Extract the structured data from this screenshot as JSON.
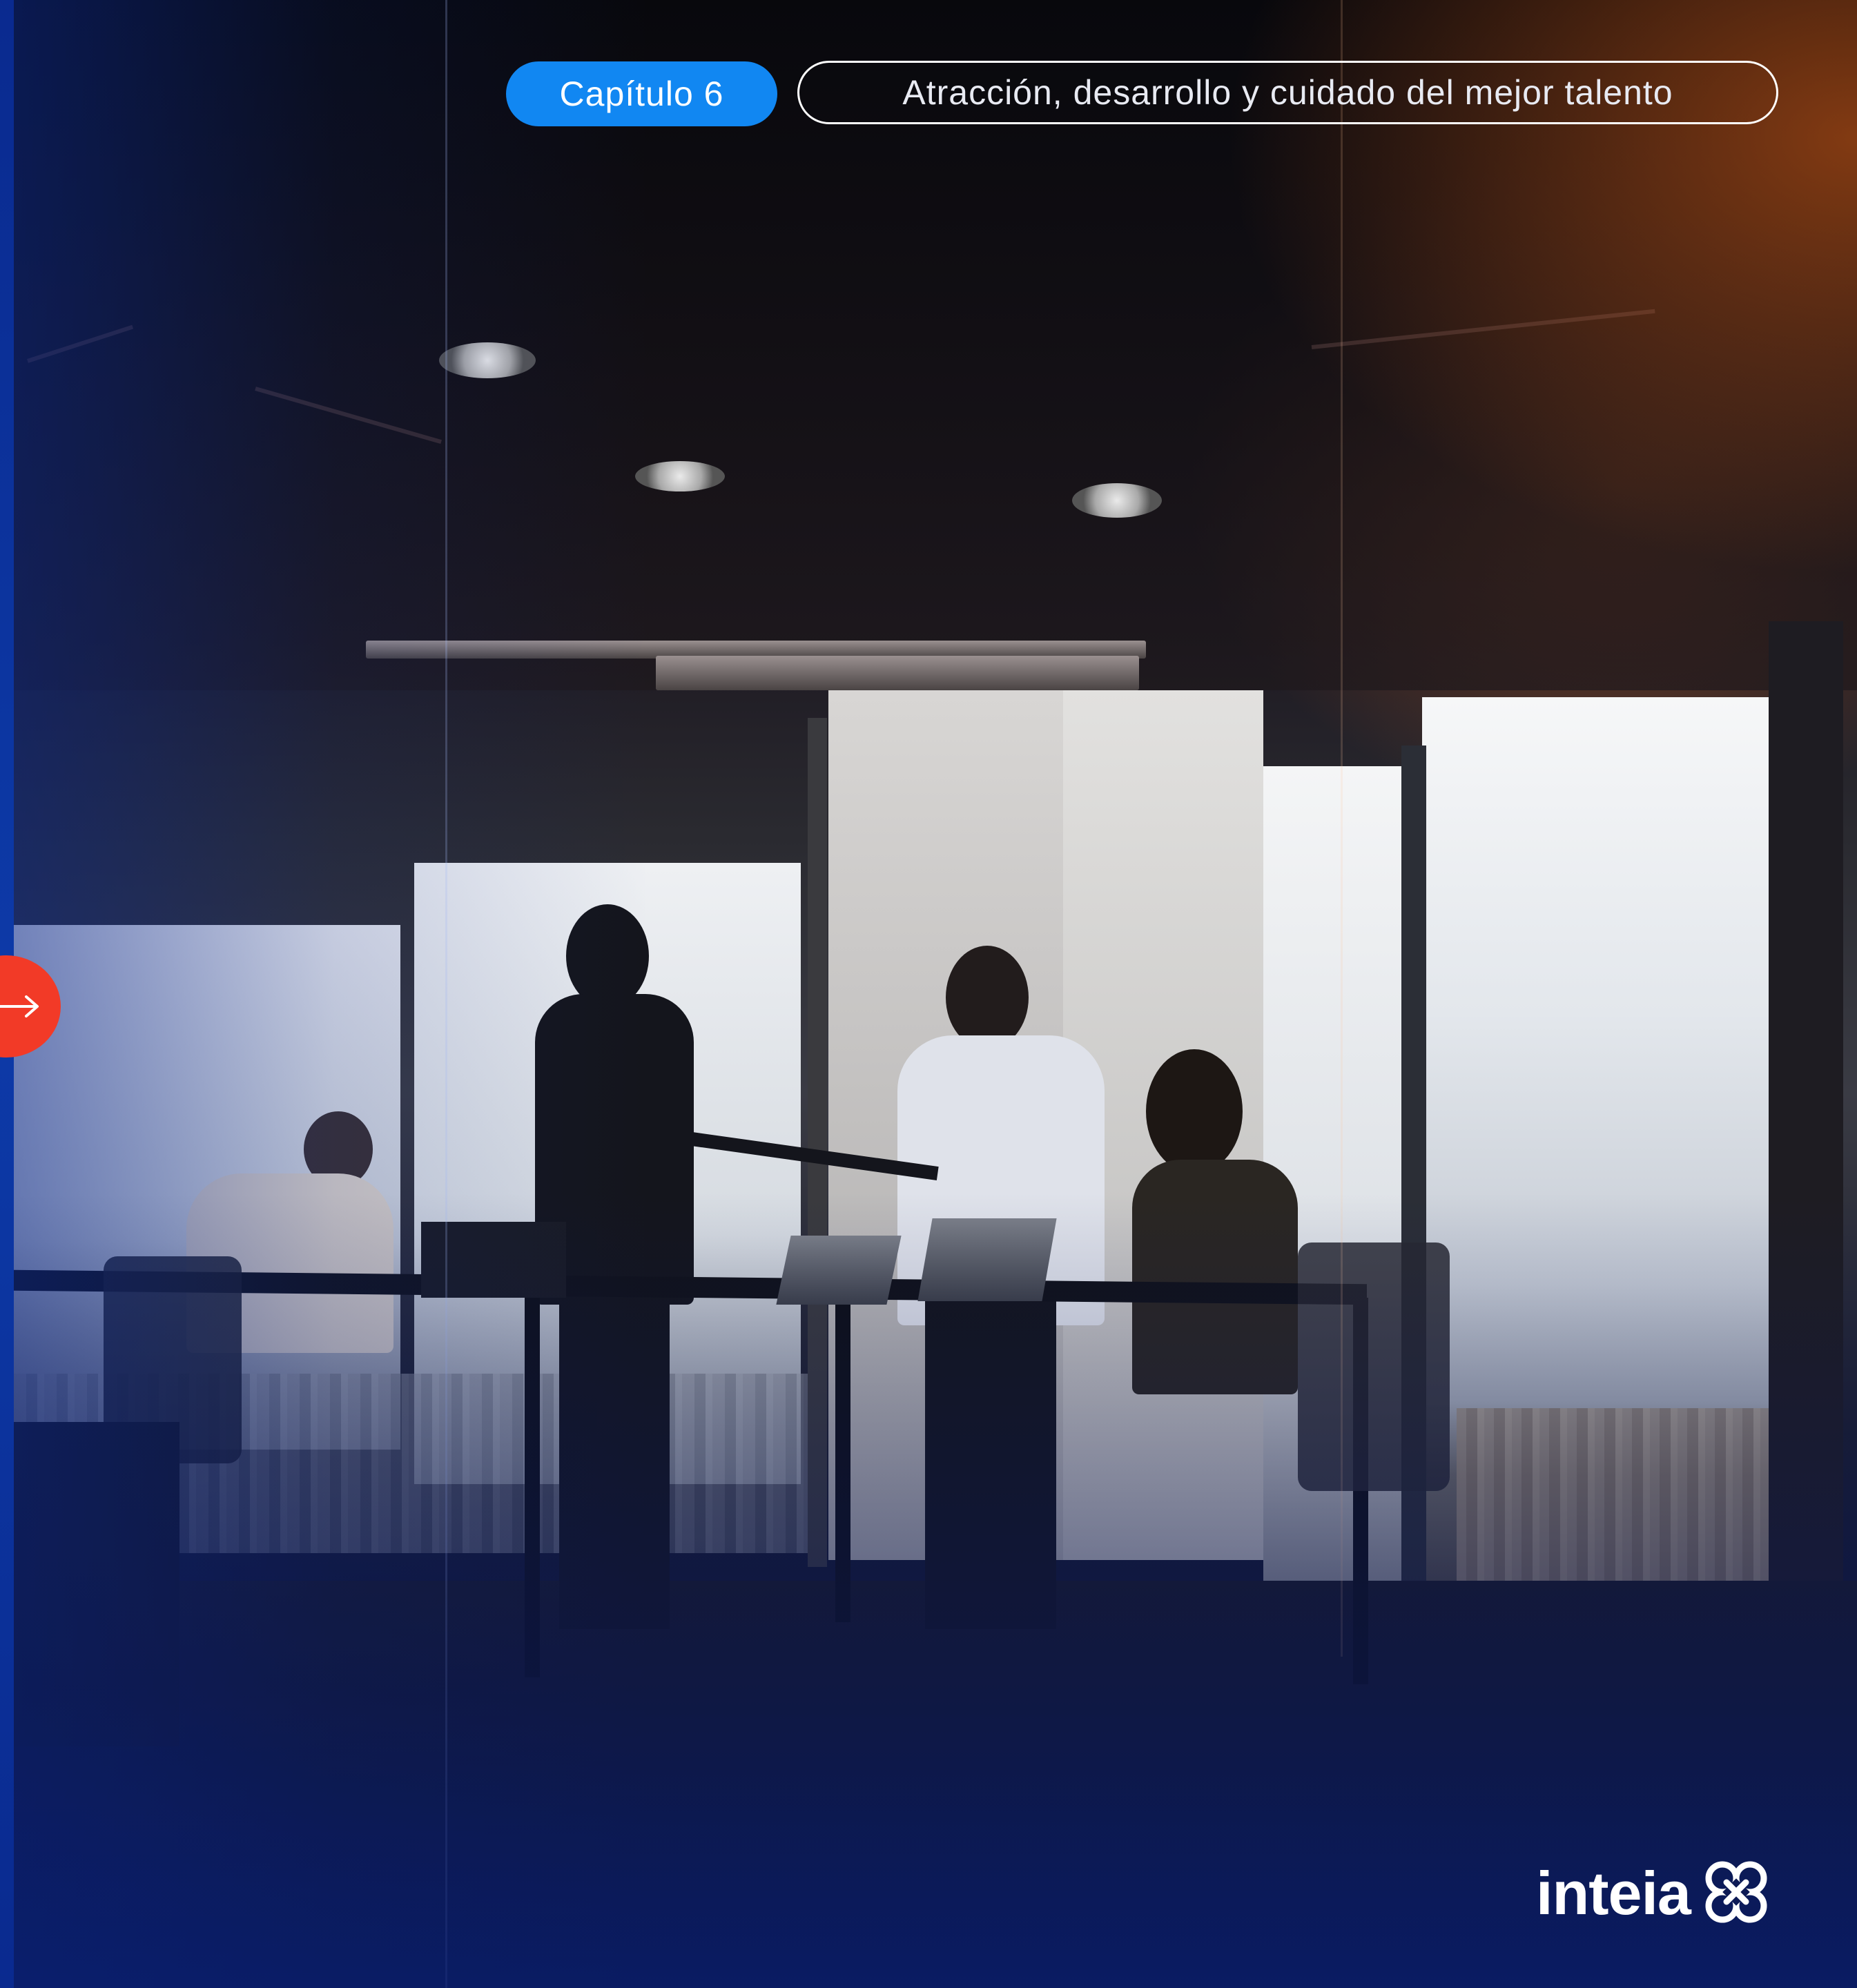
{
  "header": {
    "chapter_label": "Capítulo 6",
    "chapter_title": "Atracción, desarrollo y cuidado del mejor talento"
  },
  "navigation": {
    "next_icon": "arrow-right-icon"
  },
  "brand": {
    "logo_text": "inteia",
    "logo_icon": "inteia-knot-icon"
  },
  "colors": {
    "chapter_pill": "#1187f2",
    "next_button": "#f23a27",
    "outline": "#ffffff",
    "edge_strip": "#0d3aa8"
  }
}
